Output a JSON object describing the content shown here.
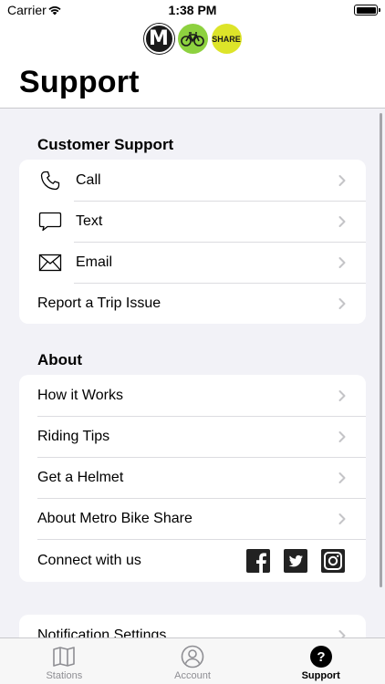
{
  "status_bar": {
    "carrier": "Carrier",
    "time": "1:38 PM"
  },
  "header": {
    "title": "Support",
    "logos": {
      "metro_letter": "M",
      "share_label": "SHARE"
    }
  },
  "sections": {
    "customer_support": {
      "title": "Customer Support",
      "items": [
        {
          "label": "Call",
          "icon": "phone-icon"
        },
        {
          "label": "Text",
          "icon": "speech-bubble-icon"
        },
        {
          "label": "Email",
          "icon": "envelope-icon"
        },
        {
          "label": "Report a Trip Issue"
        }
      ]
    },
    "about": {
      "title": "About",
      "items": [
        {
          "label": "How it Works"
        },
        {
          "label": "Riding Tips"
        },
        {
          "label": "Get a Helmet"
        },
        {
          "label": "About Metro Bike Share"
        },
        {
          "label": "Connect with us",
          "social": [
            "facebook-icon",
            "twitter-icon",
            "instagram-icon"
          ]
        }
      ]
    },
    "settings": {
      "items": [
        {
          "label": "Notification Settings"
        }
      ]
    }
  },
  "tab_bar": {
    "tabs": [
      {
        "label": "Stations",
        "icon": "map-icon",
        "active": false
      },
      {
        "label": "Account",
        "icon": "person-icon",
        "active": false
      },
      {
        "label": "Support",
        "icon": "question-icon",
        "active": true
      }
    ]
  },
  "colors": {
    "background": "#f2f2f7",
    "bike_logo": "#8dd13f",
    "share_logo": "#dde429",
    "chevron": "#c4c4c7"
  }
}
